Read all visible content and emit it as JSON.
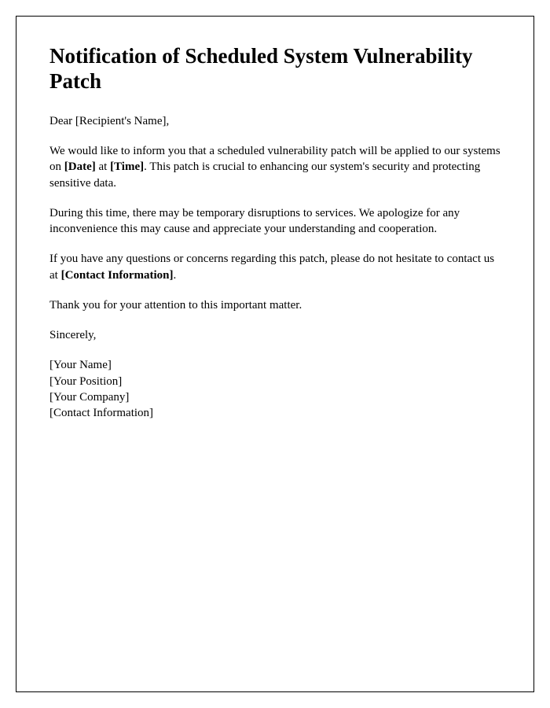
{
  "title": "Notification of Scheduled System Vulnerability Patch",
  "salutation": {
    "prefix": "Dear ",
    "placeholder": "[Recipient's Name]",
    "suffix": ","
  },
  "para1": {
    "part1": "We would like to inform you that a scheduled vulnerability patch will be applied to our systems on ",
    "date_placeholder": "[Date]",
    "part2": " at ",
    "time_placeholder": "[Time]",
    "part3": ". This patch is crucial to enhancing our system's security and protecting sensitive data."
  },
  "para2": "During this time, there may be temporary disruptions to services. We apologize for any inconvenience this may cause and appreciate your understanding and cooperation.",
  "para3": {
    "part1": "If you have any questions or concerns regarding this patch, please do not hesitate to contact us at ",
    "contact_placeholder": "[Contact Information]",
    "part2": "."
  },
  "para4": "Thank you for your attention to this important matter.",
  "closing": "Sincerely,",
  "signature": {
    "name": "[Your Name]",
    "position": "[Your Position]",
    "company": "[Your Company]",
    "contact": "[Contact Information]"
  }
}
